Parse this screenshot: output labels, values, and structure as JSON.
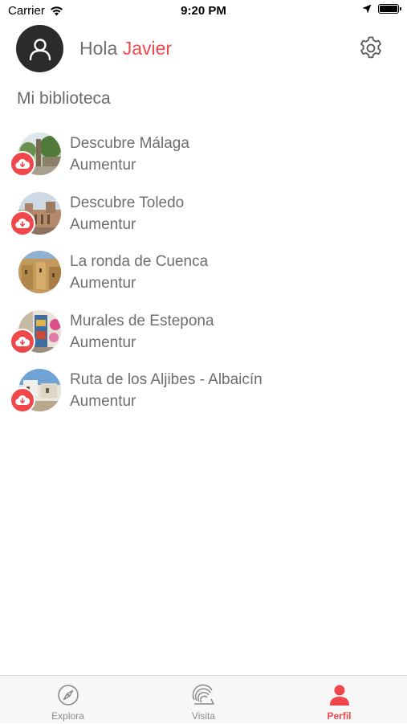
{
  "status_bar": {
    "carrier": "Carrier",
    "time": "9:20 PM"
  },
  "header": {
    "greeting": "Hola",
    "user_name": "Javier"
  },
  "library": {
    "title": "Mi biblioteca",
    "items": [
      {
        "title": "Descubre Málaga",
        "author": "Aumentur",
        "downloadable": true
      },
      {
        "title": "Descubre Toledo",
        "author": "Aumentur",
        "downloadable": true
      },
      {
        "title": "La ronda de Cuenca",
        "author": "Aumentur",
        "downloadable": false
      },
      {
        "title": "Murales de Estepona",
        "author": "Aumentur",
        "downloadable": true
      },
      {
        "title": "Ruta de los Aljibes - Albaicín",
        "author": "Aumentur",
        "downloadable": true
      }
    ]
  },
  "tab_bar": {
    "tabs": [
      {
        "label": "Explora",
        "icon": "compass-icon",
        "active": false
      },
      {
        "label": "Visita",
        "icon": "ar-visit-icon",
        "active": false
      },
      {
        "label": "Perfil",
        "icon": "user-icon",
        "active": true
      }
    ]
  },
  "colors": {
    "accent": "#f0474b",
    "text": "#6e6e6e",
    "tab_bar_bg": "#f7f7f7"
  }
}
